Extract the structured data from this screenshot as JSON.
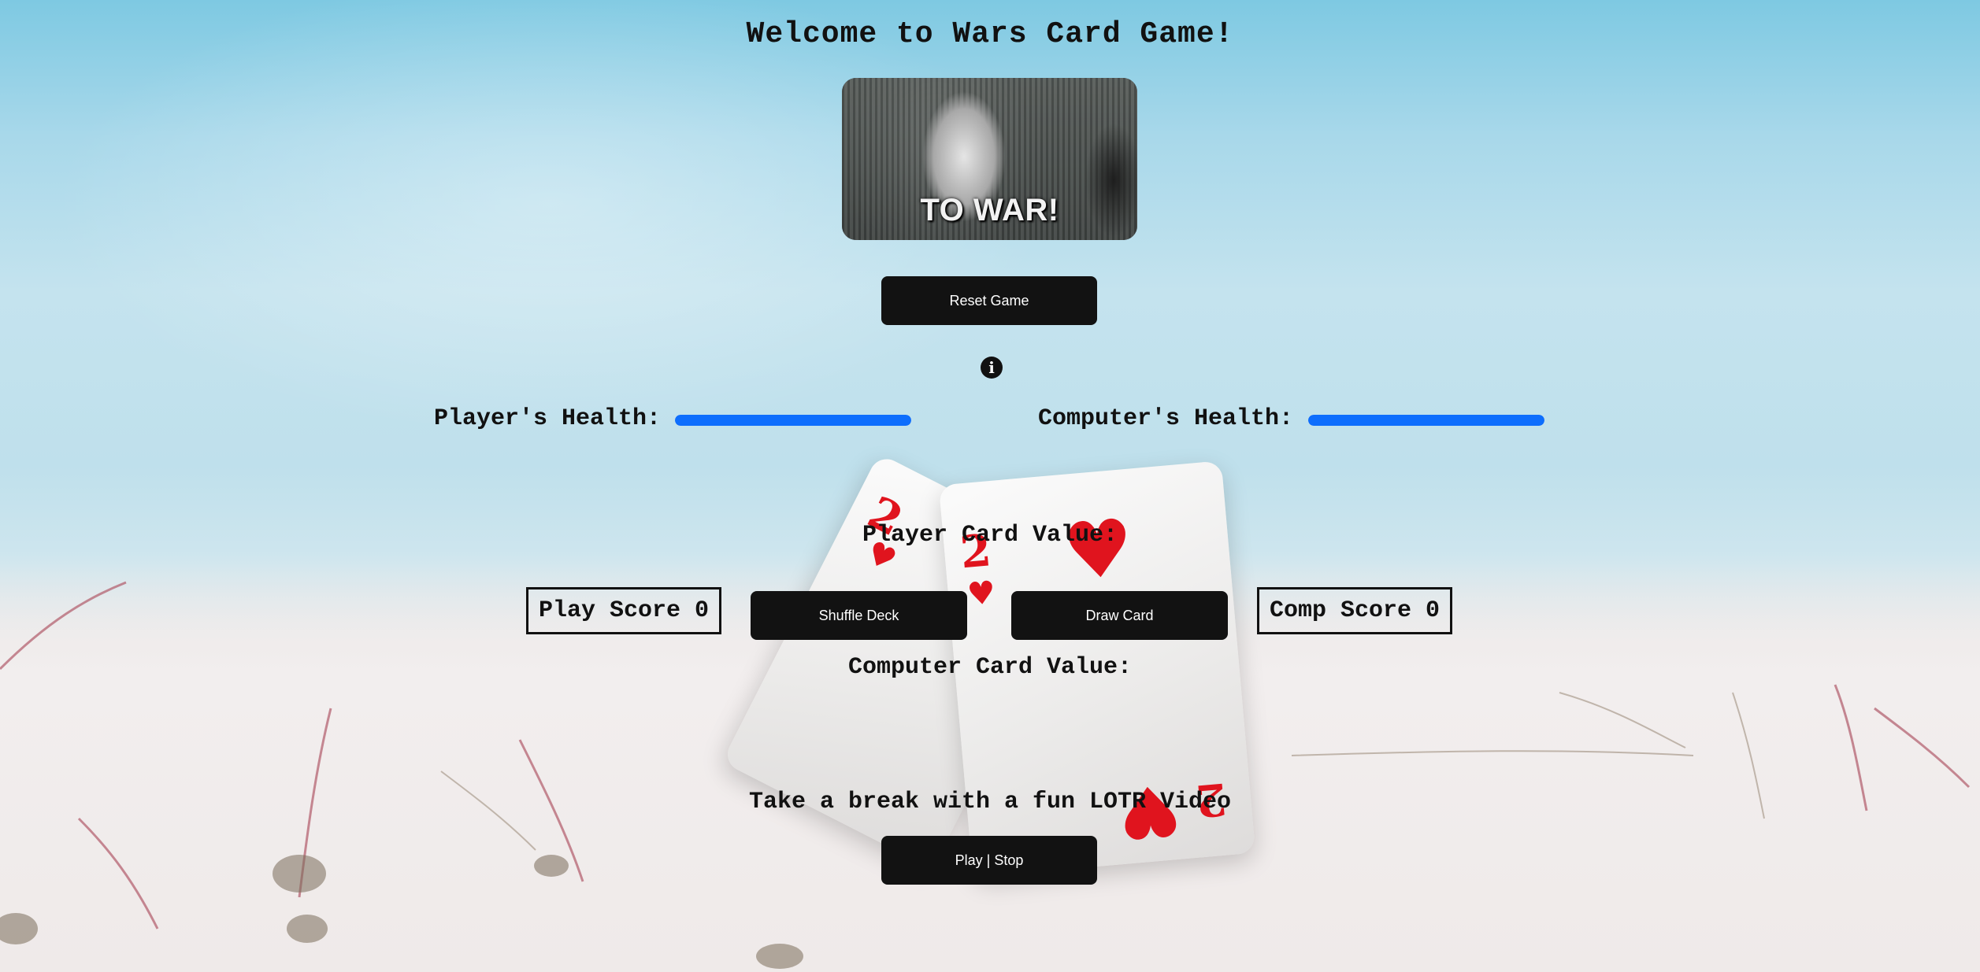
{
  "header": {
    "title": "Welcome to Wars Card Game!",
    "banner_caption": "TO WAR!"
  },
  "controls": {
    "reset_label": "Reset Game",
    "shuffle_label": "Shuffle Deck",
    "draw_label": "Draw Card",
    "play_stop_label": "Play | Stop"
  },
  "info": {
    "icon": "info-circle-icon",
    "glyph": "i"
  },
  "health": {
    "player_label": "Player's Health:",
    "computer_label": "Computer's Health:",
    "player_value": 100,
    "computer_value": 100,
    "bar_color": "#0d6efd"
  },
  "cards": {
    "player_value_label": "Player Card Value:",
    "computer_value_label": "Computer Card Value:"
  },
  "scores": {
    "player_score_text": "Play Score 0",
    "computer_score_text": "Comp Score 0"
  },
  "video": {
    "label": "Take a break with a fun LOTR Video"
  },
  "background": {
    "cards": [
      {
        "rank": "2",
        "suit": "♥"
      },
      {
        "rank": "2",
        "suit": "♥"
      }
    ]
  }
}
